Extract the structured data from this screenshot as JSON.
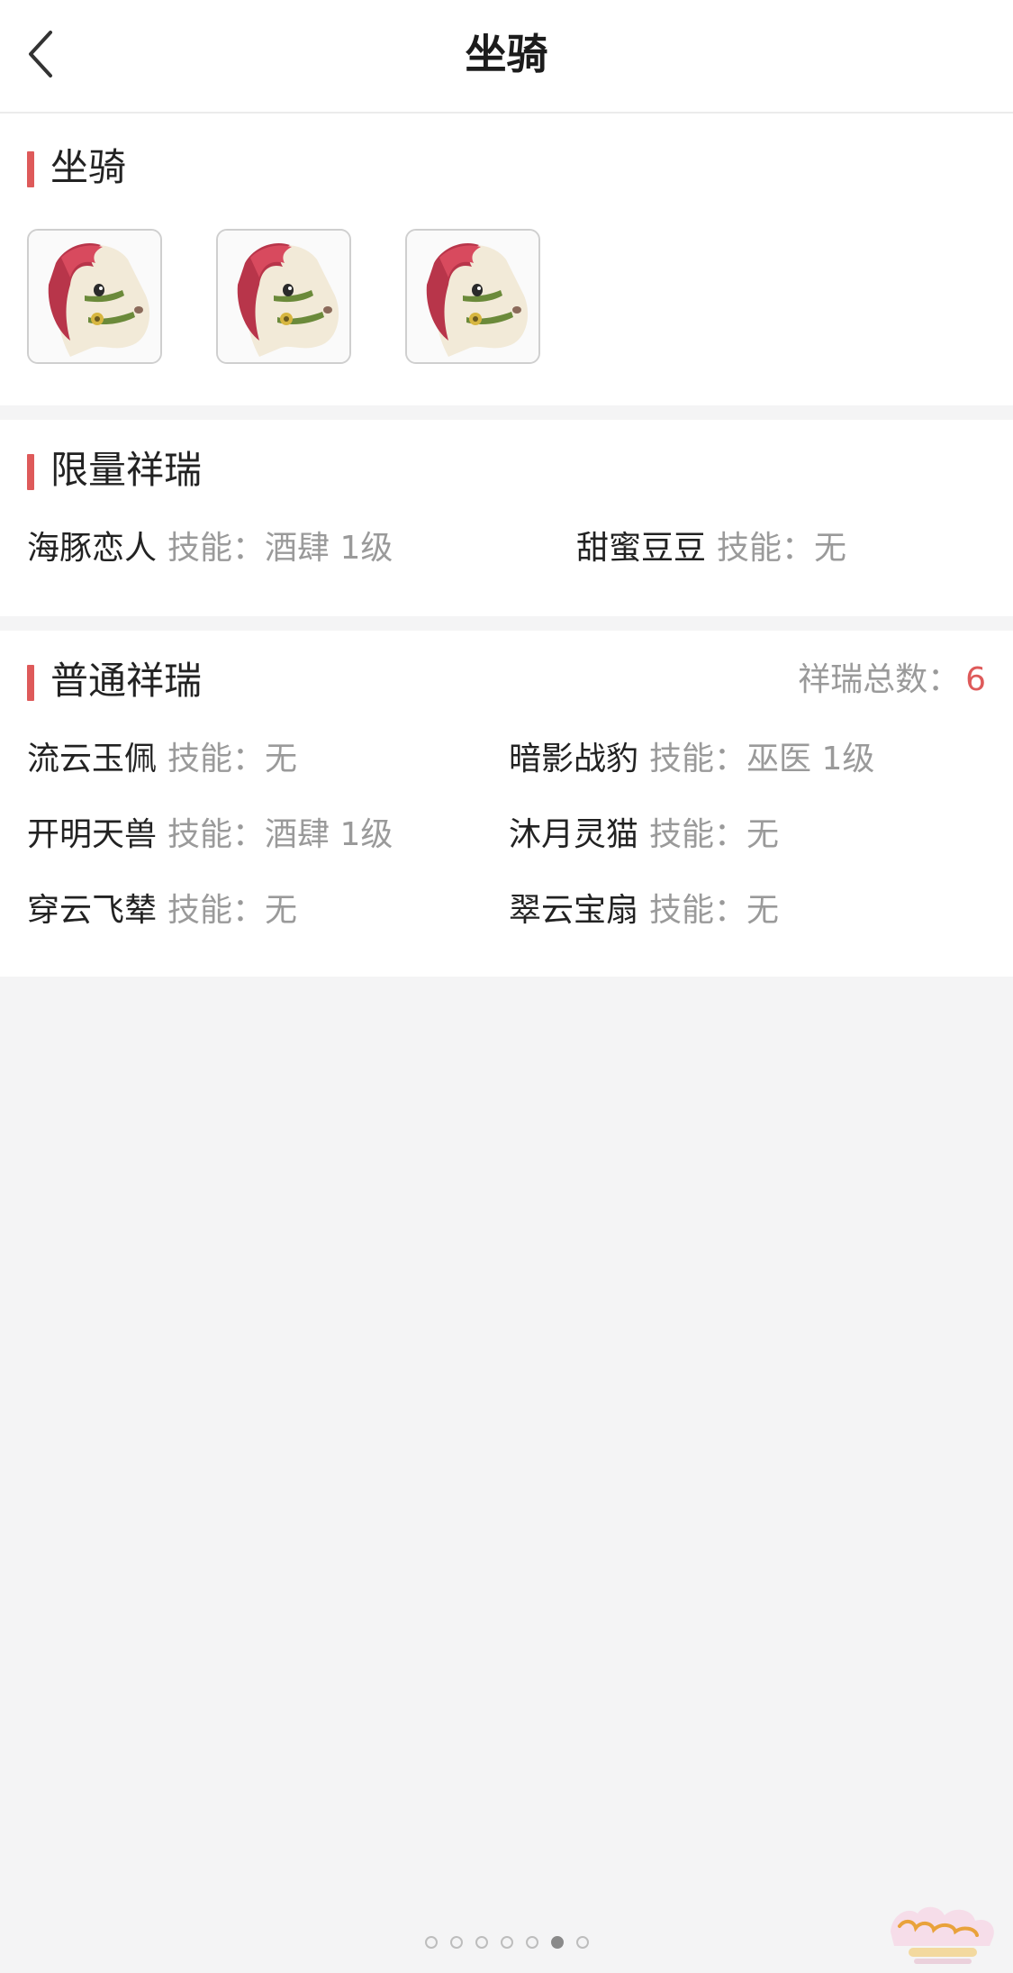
{
  "header": {
    "title": "坐骑"
  },
  "mounts_section": {
    "title": "坐骑",
    "items": [
      {
        "icon": "horse-mount-icon"
      },
      {
        "icon": "horse-mount-icon"
      },
      {
        "icon": "horse-mount-icon"
      }
    ]
  },
  "limited_section": {
    "title": "限量祥瑞",
    "items": [
      {
        "name": "海豚恋人",
        "skill_label": "技能：",
        "skill": "酒肆 1级"
      },
      {
        "name": "甜蜜豆豆",
        "skill_label": "技能：",
        "skill": "无"
      }
    ]
  },
  "normal_section": {
    "title": "普通祥瑞",
    "total_label": "祥瑞总数：",
    "total": "6",
    "items": [
      {
        "name": "流云玉佩",
        "skill_label": "技能：",
        "skill": "无"
      },
      {
        "name": "暗影战豹",
        "skill_label": "技能：",
        "skill": "巫医 1级"
      },
      {
        "name": "开明天兽",
        "skill_label": "技能：",
        "skill": "酒肆 1级"
      },
      {
        "name": "沐月灵猫",
        "skill_label": "技能：",
        "skill": "无"
      },
      {
        "name": "穿云飞辇",
        "skill_label": "技能：",
        "skill": "无"
      },
      {
        "name": "翠云宝扇",
        "skill_label": "技能：",
        "skill": "无"
      }
    ]
  },
  "pagination": {
    "total_pages": 7,
    "current_page": 6
  },
  "colors": {
    "accent": "#de5a5a",
    "muted_text": "#9a9a9a",
    "background": "#f4f4f5"
  }
}
